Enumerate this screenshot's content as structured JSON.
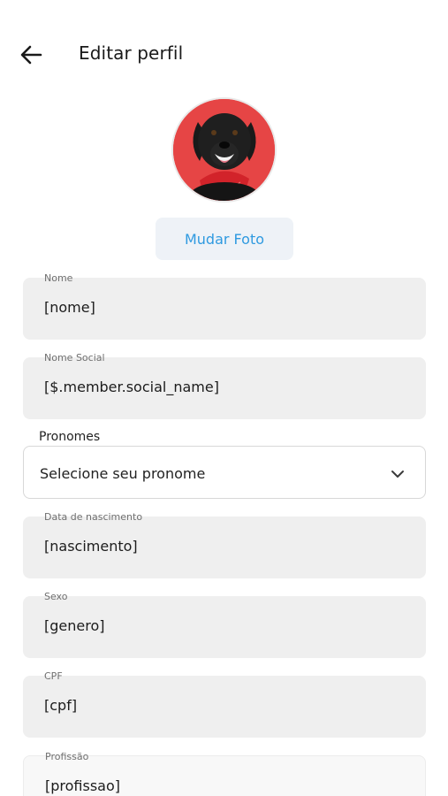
{
  "header": {
    "title": "Editar perfil",
    "back_icon": "arrow-left-icon"
  },
  "profile": {
    "avatar": "dog-photo",
    "change_photo_label": "Mudar Foto"
  },
  "fields": {
    "nome": {
      "label": "Nome",
      "value": "[nome]"
    },
    "nome_social": {
      "label": "Nome Social",
      "value": "[$.member.social_name]"
    },
    "pronomes": {
      "label": "Pronomes",
      "placeholder": "Selecione seu pronome",
      "icon": "chevron-down-icon"
    },
    "nascimento": {
      "label": "Data de nascimento",
      "value": "[nascimento]"
    },
    "sexo": {
      "label": "Sexo",
      "value": "[genero]"
    },
    "cpf": {
      "label": "CPF",
      "value": "[cpf]"
    },
    "profissao": {
      "label": "Profissão",
      "value": "[profissao]"
    }
  },
  "colors": {
    "accent": "#2f9ae0",
    "field_bg": "#efefef",
    "button_bg": "#eef2f7"
  }
}
